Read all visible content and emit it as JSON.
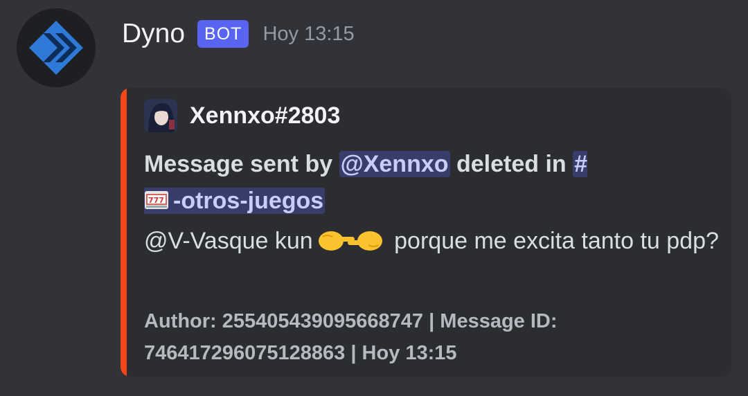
{
  "message": {
    "author": "Dyno",
    "badge": "BOT",
    "timestamp": "Hoy 13:15"
  },
  "embed": {
    "accent_color": "#f24718",
    "author_name": "Xennxo#2803",
    "title_prefix": "Message sent by ",
    "title_mention": "@Xennxo",
    "title_middle": " deleted in ",
    "channel_hash": "#",
    "channel_icon": "slot-machine-icon",
    "channel_name": "-otros-juegos",
    "description_part1": "@V-Vasque kun",
    "description_emoji": "pointing-hands-icon",
    "description_part2": " porque me excita tanto tu pdp?",
    "footer": "Author: 255405439095668747 | Message ID: 746417296075128863 | Hoy 13:15"
  }
}
